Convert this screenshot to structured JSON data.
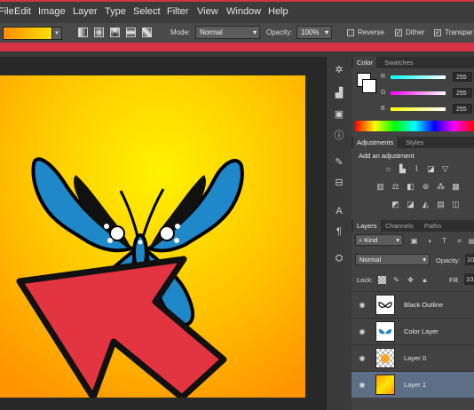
{
  "menu": [
    "File",
    "Edit",
    "Image",
    "Layer",
    "Type",
    "Select",
    "Filter",
    "View",
    "Window",
    "Help"
  ],
  "options": {
    "mode_label": "Mode:",
    "mode_value": "Normal",
    "opacity_label": "Opacity:",
    "opacity_value": "100%",
    "reverse_label": "Reverse",
    "dither_label": "Dither",
    "transparency_label": "Transpar"
  },
  "color_panel": {
    "tabs": [
      "Color",
      "Swatches"
    ],
    "r_label": "R",
    "g_label": "G",
    "b_label": "B",
    "r_value": "255",
    "g_value": "255",
    "b_value": "255"
  },
  "adjustments_panel": {
    "tabs": [
      "Adjustments",
      "Styles"
    ],
    "heading": "Add an adjustment"
  },
  "layers_panel": {
    "tabs": [
      "Layers",
      "Channels",
      "Paths"
    ],
    "kind_label": "Kind",
    "blend_mode": "Normal",
    "opacity_label": "Opacity:",
    "opacity_value": "10",
    "lock_label": "Lock:",
    "fill_label": "Fill:",
    "fill_value": "10",
    "layers": [
      {
        "name": "Black Outline"
      },
      {
        "name": "Color Layer"
      },
      {
        "name": "Layer 0"
      },
      {
        "name": "Layer 1"
      }
    ]
  },
  "colors": {
    "accent_red": "#d63245",
    "gradient_start": "#ff9800",
    "gradient_end": "#ffee00",
    "butterfly_blue": "#1e88c8",
    "selected_layer": "#5d6f86"
  }
}
